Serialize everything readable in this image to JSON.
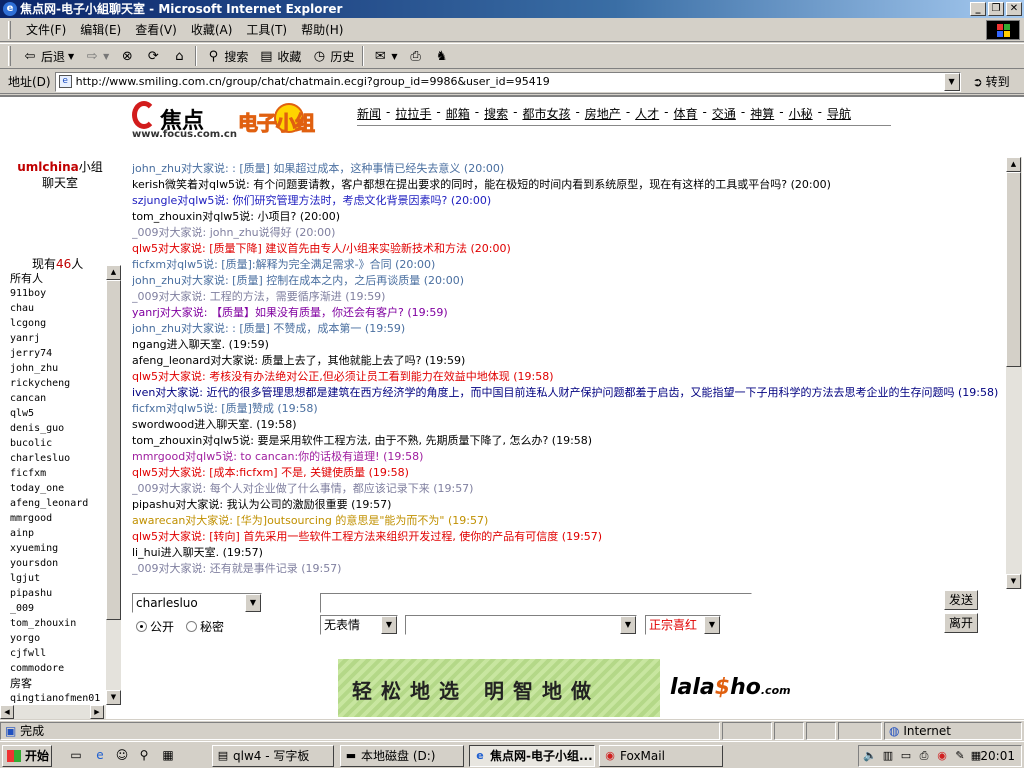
{
  "window": {
    "title": "焦点网-电子小組聊天室 - Microsoft Internet Explorer"
  },
  "menu": [
    "文件(F)",
    "编辑(E)",
    "查看(V)",
    "收藏(A)",
    "工具(T)",
    "帮助(H)"
  ],
  "toolbar": {
    "back": "后退",
    "search": "搜索",
    "favorites": "收藏",
    "history": "历史"
  },
  "address": {
    "label": "地址(D)",
    "url": "http://www.smiling.com.cn/group/chat/chatmain.ecgi?group_id=9986&user_id=95419",
    "go": "转到"
  },
  "header": {
    "focus_logo": "焦点",
    "focus_url": "www.focus.com.cn",
    "group_logo": "电子小组",
    "nav": [
      "新闻",
      "拉拉手",
      "邮箱",
      "搜索",
      "都市女孩",
      "房地产",
      "人才",
      "体育",
      "交通",
      "神算",
      "小秘",
      "导航"
    ]
  },
  "room": {
    "name": "umlchina",
    "suffix": "小组聊天室",
    "online_prefix": "现有",
    "online_count": "46",
    "online_suffix": "人"
  },
  "users": [
    "所有人",
    "911boy",
    "chau",
    "lcgong",
    "yanrj",
    "jerry74",
    "john_zhu",
    "rickycheng",
    "cancan",
    "qlw5",
    "denis_guo",
    "bucolic",
    "charlesluo",
    "ficfxm",
    "today_one",
    "afeng_leonard",
    "mmrgood",
    "ainp",
    "xyueming",
    "yoursdon",
    "lgjut",
    "pipashu",
    "_009",
    "tom_zhouxin",
    "yorgo",
    "cjfwll",
    "commodore",
    "房客",
    "qingtianofmen01"
  ],
  "messages": [
    {
      "text": "john_zhu对大家说: : [质量] 如果超过成本，这种事情已经失去意义 (20:00)",
      "color": "#4a6fa0"
    },
    {
      "text": "kerish微笑着对qlw5说: 有个问题要请教，客户都想在提出要求的同时，能在极短的时间内看到系统原型，现在有这样的工具或平台吗? (20:00)",
      "color": "#000000"
    },
    {
      "text": "szjungle对qlw5说: 你们研究管理方法时，考虑文化背景因素吗? (20:00)",
      "color": "#2020c0"
    },
    {
      "text": "tom_zhouxin对qlw5说: 小项目? (20:00)",
      "color": "#000000"
    },
    {
      "text": "_009对大家说: john_zhu说得好 (20:00)",
      "color": "#8080a0"
    },
    {
      "text": "qlw5对大家说: [质量下降] 建议首先由专人/小组来实验新技术和方法 (20:00)",
      "color": "#e00000"
    },
    {
      "text": "ficfxm对qlw5说: [质量]:解释为完全满足需求-》合同 (20:00)",
      "color": "#4a6fa0"
    },
    {
      "text": "john_zhu对大家说: [质量] 控制在成本之内，之后再谈质量 (20:00)",
      "color": "#4a6fa0"
    },
    {
      "text": "_009对大家说: 工程的方法，需要循序渐进 (19:59)",
      "color": "#8080a0"
    },
    {
      "text": "yanrj对大家说: 【质量】如果没有质量，你还会有客户? (19:59)",
      "color": "#8000a0"
    },
    {
      "text": "john_zhu对大家说: : [质量] 不赞成，成本第一 (19:59)",
      "color": "#4a6fa0"
    },
    {
      "text": "ngang进入聊天室. (19:59)",
      "color": "#000000"
    },
    {
      "text": "afeng_leonard对大家说: 质量上去了，其他就能上去了吗? (19:59)",
      "color": "#000000"
    },
    {
      "text": "qlw5对大家说: 考核没有办法绝对公正,但必须让员工看到能力在效益中地体现 (19:58)",
      "color": "#e00000"
    },
    {
      "text": "iven对大家说: 近代的很多管理思想都是建筑在西方经济学的角度上，而中国目前连私人财产保护问题都羞于启齿，又能指望一下子用科学的方法去思考企业的生存问题吗 (19:58)",
      "color": "#000080"
    },
    {
      "text": "ficfxm对qlw5说: [质量]赞成 (19:58)",
      "color": "#4a6fa0"
    },
    {
      "text": "swordwood进入聊天室. (19:58)",
      "color": "#000000"
    },
    {
      "text": "tom_zhouxin对qlw5说: 要是采用软件工程方法, 由于不熟, 先期质量下降了, 怎么办? (19:58)",
      "color": "#000000"
    },
    {
      "text": "mmrgood对qlw5说: to cancan:你的话极有道理! (19:58)",
      "color": "#a020a0"
    },
    {
      "text": "qlw5对大家说: [成本:ficfxm] 不是, 关键使质量 (19:58)",
      "color": "#e00000"
    },
    {
      "text": "_009对大家说: 每个人对企业做了什么事情，都应该记录下来 (19:57)",
      "color": "#8080a0"
    },
    {
      "text": "pipashu对大家说: 我认为公司的激励很重要 (19:57)",
      "color": "#000000"
    },
    {
      "text": "awarecan对大家说: [华为]outsourcing 的意思是\"能为而不为\" (19:57)",
      "color": "#c09000"
    },
    {
      "text": "qlw5对大家说: [转向] 首先采用一些软件工程方法来组织开发过程, 使你的产品有可信度 (19:57)",
      "color": "#e00000"
    },
    {
      "text": "li_hui进入聊天室. (19:57)",
      "color": "#000000"
    },
    {
      "text": "_009对大家说: 还有就是事件记录 (19:57)",
      "color": "#8080a0"
    }
  ],
  "input": {
    "target_user": "charlesluo",
    "radio_public": "公开",
    "radio_private": "秘密",
    "expression": "无表情",
    "color_select": "正宗喜红",
    "send": "发送",
    "leave": "离开"
  },
  "ad": {
    "slogan": "轻松地选 明智地做",
    "brand": "lala",
    "brand_mid": "ho",
    "brand_dom": ".com"
  },
  "status": {
    "text": "完成",
    "zone": "Internet"
  },
  "taskbar": {
    "start": "开始",
    "tasks": [
      "qlw4 - 写字板",
      "本地磁盘 (D:)",
      "焦点网-电子小组...",
      "FoxMail"
    ],
    "clock": "20:01"
  }
}
